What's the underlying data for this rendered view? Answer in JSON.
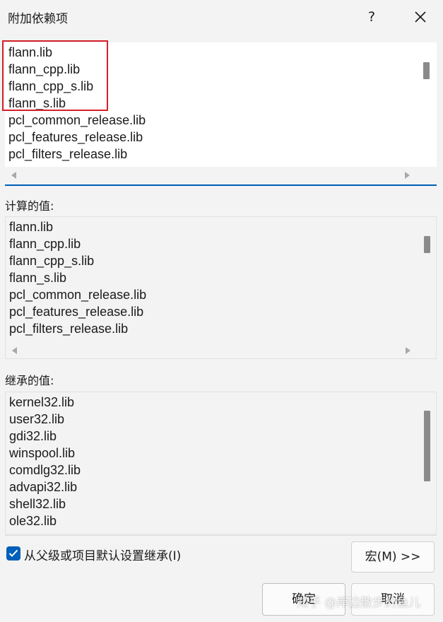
{
  "window": {
    "title": "附加依赖项",
    "help_label": "?"
  },
  "edit_list": {
    "lines": [
      "flann.lib",
      "flann_cpp.lib",
      "flann_cpp_s.lib",
      "flann_s.lib",
      "pcl_common_release.lib",
      "pcl_features_release.lib",
      "pcl_filters_release.lib"
    ]
  },
  "computed": {
    "label": "计算的值:",
    "lines": [
      "flann.lib",
      "flann_cpp.lib",
      "flann_cpp_s.lib",
      "flann_s.lib",
      "pcl_common_release.lib",
      "pcl_features_release.lib",
      "pcl_filters_release.lib"
    ]
  },
  "inherited": {
    "label": "继承的值:",
    "lines": [
      "kernel32.lib",
      "user32.lib",
      "gdi32.lib",
      "winspool.lib",
      "comdlg32.lib",
      "advapi32.lib",
      "shell32.lib",
      "ole32.lib"
    ]
  },
  "inherit_checkbox": {
    "label": "从父级或项目默认设置继承(I)",
    "checked": true
  },
  "buttons": {
    "macro": "宏(M) >>",
    "ok": "确定",
    "cancel": "取消"
  },
  "watermark": "知乎 @岸边散步的鱼儿",
  "colors": {
    "accent": "#005fb8",
    "highlight": "#d4202a"
  },
  "icons": {
    "close": "close-icon",
    "check": "check-icon"
  }
}
